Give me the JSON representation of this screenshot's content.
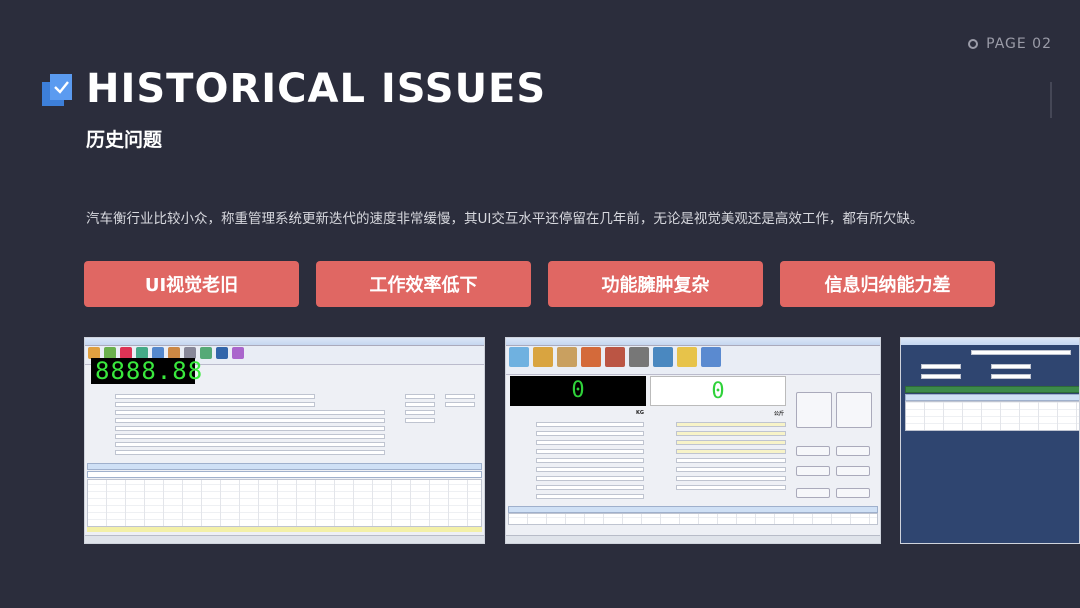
{
  "page": {
    "label": "PAGE 02"
  },
  "header": {
    "title": "HISTORICAL ISSUES",
    "subtitle": "历史问题"
  },
  "description": "汽车衡行业比较小众，称重管理系统更新迭代的速度非常缓慢，其UI交互水平还停留在几年前，无论是视觉美观还是高效工作，都有所欠缺。",
  "tags": [
    "UI视觉老旧",
    "工作效率低下",
    "功能臃肿复杂",
    "信息归纳能力差"
  ],
  "screenshots": {
    "first": {
      "display": "8888.88"
    },
    "second": {
      "left_display": "0",
      "right_display": "0",
      "unit_left": "KG",
      "unit_right": "公斤"
    }
  },
  "colors": {
    "background": "#2b2d3c",
    "tag": "#e06763",
    "accent_blue": "#3d7fd9"
  },
  "icons": [
    "checkbox-logo-icon",
    "page-marker-icon"
  ]
}
